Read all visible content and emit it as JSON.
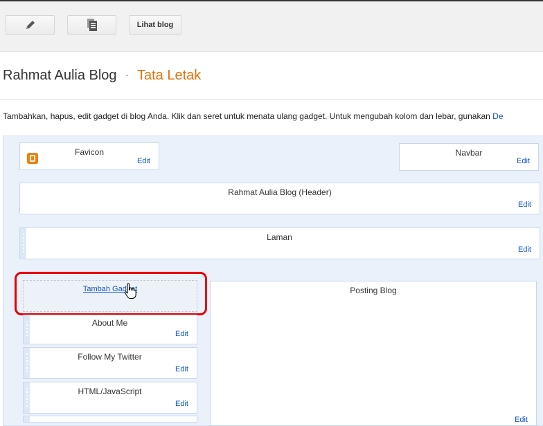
{
  "toolbar": {
    "edit_icon": "pencil-icon",
    "pages_icon": "pages-icon",
    "view_blog_label": "Lihat blog"
  },
  "header": {
    "blog_name": "Rahmat Aulia Blog",
    "separator": "·",
    "section": "Tata Letak"
  },
  "instructions": {
    "text": "Tambahkan, hapus, edit gadget di blog Anda. Klik dan seret untuk menata ulang gadget. Untuk mengubah kolom dan lebar, gunakan ",
    "link_fragment": "De"
  },
  "layout": {
    "favicon": {
      "title": "Favicon",
      "edit": "Edit"
    },
    "navbar": {
      "title": "Navbar",
      "edit": "Edit"
    },
    "header_gadget": {
      "title": "Rahmat Aulia Blog (Header)",
      "edit": "Edit"
    },
    "pages_gadget": {
      "title": "Laman",
      "edit": "Edit"
    },
    "add_gadget_link": "Tambah Gadget",
    "sidebar": [
      {
        "title": "About Me",
        "edit": "Edit"
      },
      {
        "title": "Follow My Twitter",
        "edit": "Edit"
      },
      {
        "title": "HTML/JavaScript",
        "edit": "Edit"
      }
    ],
    "main": {
      "title": "Posting Blog",
      "edit": "Edit"
    }
  },
  "colors": {
    "accent": "#e8710a",
    "link": "#1155cc",
    "highlight": "#e60000",
    "canvas": "#eaf1fb"
  }
}
